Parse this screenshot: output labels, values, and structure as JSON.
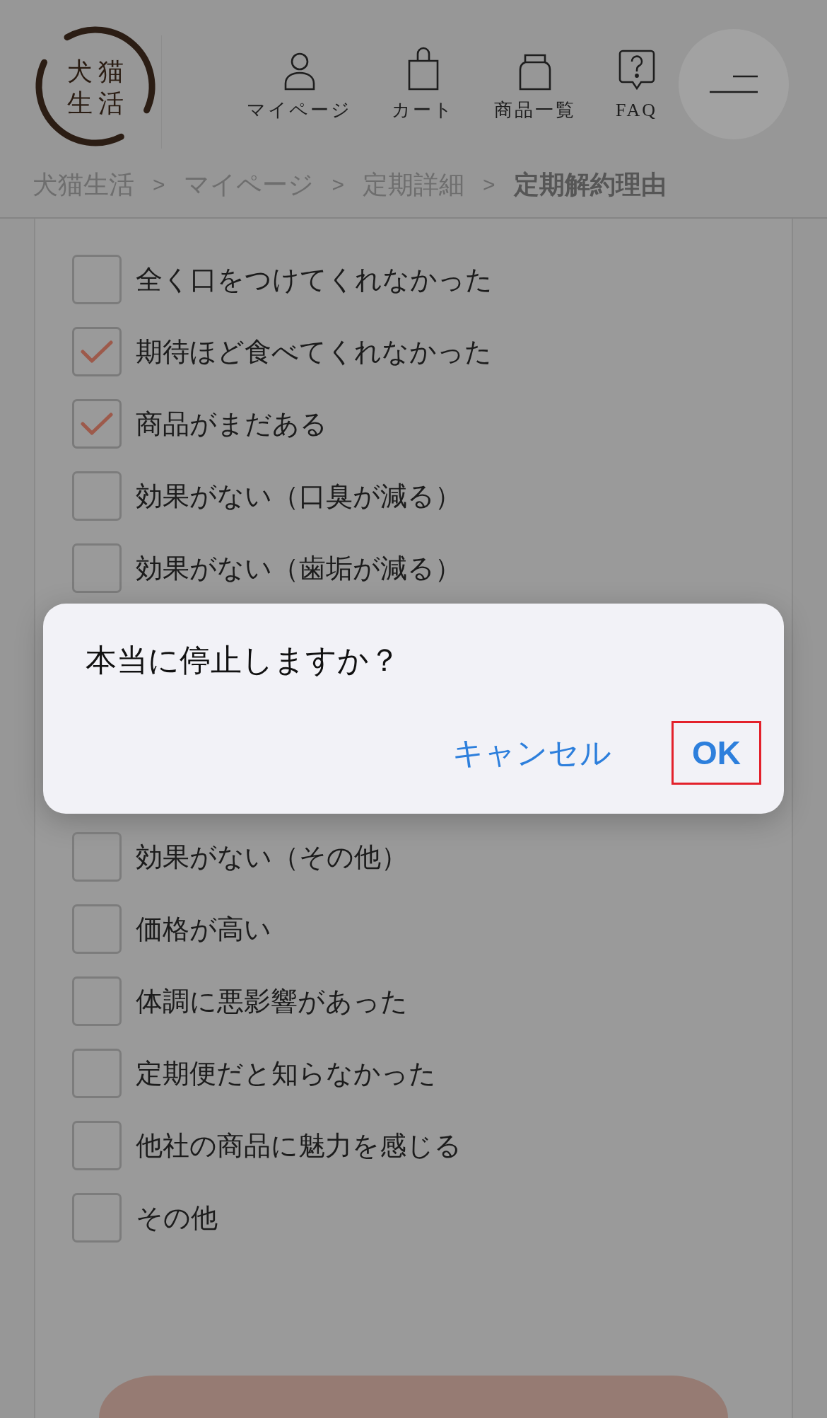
{
  "logo": {
    "lines": [
      "犬猫",
      "生活"
    ]
  },
  "nav": [
    {
      "label": "マイページ",
      "kind": "person"
    },
    {
      "label": "カート",
      "kind": "bag"
    },
    {
      "label": "商品一覧",
      "kind": "jar"
    },
    {
      "label": "FAQ",
      "kind": "question"
    }
  ],
  "breadcrumb": {
    "items": [
      {
        "label": "犬猫生活",
        "current": false
      },
      {
        "label": "マイページ",
        "current": false
      },
      {
        "label": "定期詳細",
        "current": false
      },
      {
        "label": "定期解約理由",
        "current": true
      }
    ],
    "separators": [
      ">",
      ">",
      ">"
    ]
  },
  "checklist_top": [
    {
      "label": "全く口をつけてくれなかった",
      "checked": false
    },
    {
      "label": "期待ほど食べてくれなかった",
      "checked": true
    },
    {
      "label": "商品がまだある",
      "checked": true
    },
    {
      "label": "効果がない（口臭が減る）",
      "checked": false
    },
    {
      "label": "効果がない（歯垢が減る）",
      "checked": false
    }
  ],
  "dialog": {
    "title": "本当に停止しますか？",
    "buttons": [
      {
        "label": "キャンセル",
        "kind": "cancel",
        "highlighted": false
      },
      {
        "label": "OK",
        "kind": "confirm",
        "highlighted": true
      }
    ]
  },
  "checklist_bottom": [
    {
      "label": "効果がない（その他）",
      "checked": false
    },
    {
      "label": "価格が高い",
      "checked": false
    },
    {
      "label": "体調に悪影響があった",
      "checked": false
    },
    {
      "label": "定期便だと知らなかった",
      "checked": false
    },
    {
      "label": "他社の商品に魅力を感じる",
      "checked": false
    },
    {
      "label": "その他",
      "checked": false
    }
  ]
}
